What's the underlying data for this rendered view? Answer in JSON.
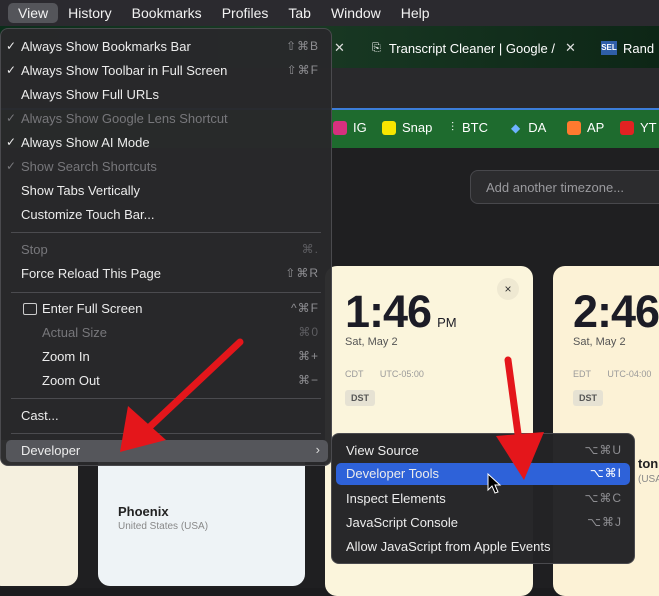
{
  "menubar": {
    "items": [
      "View",
      "History",
      "Bookmarks",
      "Profiles",
      "Tab",
      "Window",
      "Help"
    ],
    "active": "View"
  },
  "tabs": [
    {
      "title": "Transcript Cleaner | Google /"
    },
    {
      "title": "Rand",
      "favicon_text": "SEL"
    }
  ],
  "bookmarks": [
    {
      "label": "IG",
      "color": "#d6307e"
    },
    {
      "label": "Snap",
      "color": "#f7e600"
    },
    {
      "label": "BTC",
      "color": "#ffffff"
    },
    {
      "label": "DA",
      "color": "#6fb3ff"
    },
    {
      "label": "AP",
      "color": "#ff7a2f"
    },
    {
      "label": "YT",
      "color": "#e22222"
    }
  ],
  "timezone_input": {
    "placeholder": "Add another timezone..."
  },
  "cards": [
    {
      "time": "1:46",
      "ampm": "PM",
      "date": "Sat, May 2",
      "zone": "CDT",
      "offset": "UTC-05:00",
      "badge": "DST",
      "close": "×"
    },
    {
      "time": "2:46",
      "date": "Sat, May 2",
      "zone": "EDT",
      "offset": "UTC-04:00",
      "badge": "DST",
      "partial_city": "ton",
      "partial_country": "(USA)"
    },
    {
      "city": "Phoenix",
      "country": "United States (USA)"
    }
  ],
  "view_menu": {
    "items": [
      {
        "label": "Always Show Bookmarks Bar",
        "checked": true,
        "shortcut": "⇧⌘B"
      },
      {
        "label": "Always Show Toolbar in Full Screen",
        "checked": true,
        "shortcut": "⇧⌘F"
      },
      {
        "label": "Always Show Full URLs",
        "checked": false,
        "shortcut": ""
      },
      {
        "label": "Always Show Google Lens Shortcut",
        "checked": true,
        "disabled": true,
        "shortcut": ""
      },
      {
        "label": "Always Show AI Mode",
        "checked": true,
        "shortcut": ""
      },
      {
        "label": "Show Search Shortcuts",
        "checked": true,
        "disabled": true,
        "shortcut": ""
      },
      {
        "label": "Show Tabs Vertically",
        "checked": false,
        "shortcut": ""
      },
      {
        "label": "Customize Touch Bar...",
        "checked": false,
        "shortcut": ""
      },
      {
        "label": "Stop",
        "disabled": true,
        "shortcut": "⌘."
      },
      {
        "label": "Force Reload This Page",
        "shortcut": "⇧⌘R"
      },
      {
        "label": "Enter Full Screen",
        "shortcut": "^⌘F"
      },
      {
        "label": "Actual Size",
        "disabled": true,
        "shortcut": "⌘0"
      },
      {
        "label": "Zoom In",
        "shortcut": "⌘+"
      },
      {
        "label": "Zoom Out",
        "shortcut": "⌘−"
      },
      {
        "label": "Cast...",
        "shortcut": ""
      },
      {
        "label": "Developer",
        "submenu": true,
        "arrow": "›"
      }
    ]
  },
  "developer_menu": {
    "items": [
      {
        "label": "View Source",
        "shortcut": "⌥⌘U"
      },
      {
        "label": "Developer Tools",
        "shortcut": "⌥⌘I",
        "selected": true
      },
      {
        "label": "Inspect Elements",
        "shortcut": "⌥⌘C"
      },
      {
        "label": "JavaScript Console",
        "shortcut": "⌥⌘J"
      },
      {
        "label": "Allow JavaScript from Apple Events",
        "shortcut": ""
      }
    ]
  },
  "colors": {
    "selection": "#2e62d9",
    "annotation_arrow": "#e4161b",
    "bookmarks_bar": "#1e6b2e"
  }
}
